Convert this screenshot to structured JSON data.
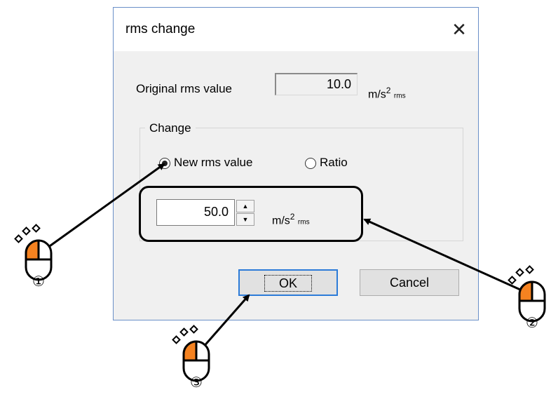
{
  "dialog": {
    "title": "rms change",
    "close_glyph": "✕",
    "original_label": "Original rms value",
    "original_value": "10.0",
    "unit_base": "m/s",
    "unit_power": "2",
    "unit_suffix": "rms",
    "group_title": "Change",
    "radio_new_label": "New rms value",
    "radio_ratio_label": "Ratio",
    "selected_option": "New rms value",
    "new_value": "50.0",
    "spin_up": "▲",
    "spin_down": "▼",
    "ok_label": "OK",
    "cancel_label": "Cancel"
  },
  "annotations": {
    "markers": [
      "①",
      "②",
      "③"
    ],
    "mouse_icon_color": "#f58220"
  }
}
